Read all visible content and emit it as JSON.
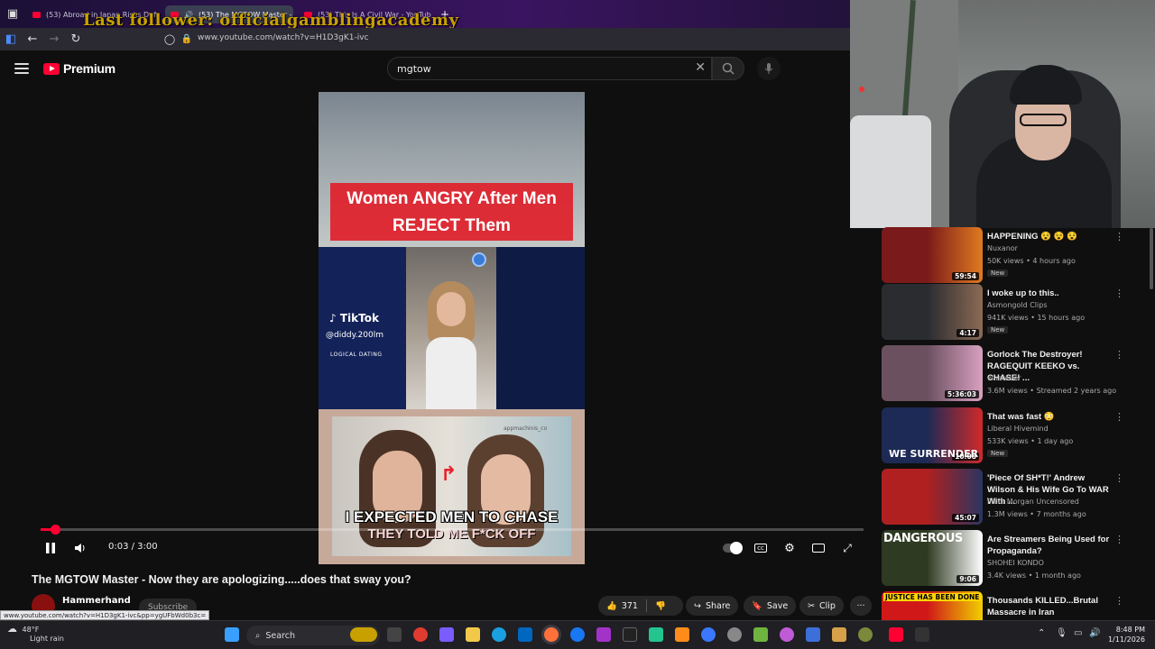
{
  "browser": {
    "tabs": [
      {
        "label": "(53) Abroad in Japan Risks Defa"
      },
      {
        "label": "(53) The MGTOW Master -"
      },
      {
        "label": "(53) This Is A Civil War - YouTub"
      }
    ],
    "new_tab_label": "+",
    "overlay_text": "Last follower: officialgamblingacademy",
    "url": "www.youtube.com/watch?v=H1D3gK1-ivc"
  },
  "youtube": {
    "brand": "Premium",
    "search_value": "mgtow",
    "accent": "#ff0033"
  },
  "video": {
    "banner_line1": "Women ANGRY After Men",
    "banner_line2": "REJECT Them",
    "tiktok_label": "TikTok",
    "tiktok_handle": "@diddy.200lm",
    "logical_label": "LOGICAL DATING",
    "caption_line1": "I EXPECTED MEN TO CHASE",
    "caption_line2": "THEY TOLD ME F*CK OFF",
    "watermark": "appmachinis_co"
  },
  "player": {
    "time": "0:03 / 3:00",
    "progress": 0.017
  },
  "meta": {
    "title": "The MGTOW Master - Now they are apologizing.....does that sway you?",
    "channel": "Hammerhand",
    "subscribe": "Subscribe",
    "likes": "371",
    "share": "Share",
    "save": "Save",
    "clip": "Clip",
    "more": "···",
    "status_url": "www.youtube.com/watch?v=H1D3gK1-ivc&pp=ygUFbWd0b3c="
  },
  "recommendations": [
    {
      "title": "HAPPENING 😵 😵 😵",
      "channel": "Nuxanor",
      "meta": "50K views • 4 hours ago",
      "badge": "New",
      "duration": "59:54",
      "thumb": "#7a1a1a",
      "thumb2": "#e07a20"
    },
    {
      "title": "I woke up to this..",
      "channel": "Asmongold Clips",
      "meta": "941K views • 15 hours ago",
      "badge": "New",
      "duration": "4:17",
      "thumb": "#2a2c30",
      "thumb2": "#8b6a55"
    },
    {
      "title": "Gorlock The Destroyer! RAGEQUIT KEEKO vs. CHASE! ...",
      "channel": "whatever",
      "meta": "3.6M views • Streamed 2 years ago",
      "badge": "",
      "duration": "5:36:03",
      "thumb": "#6b5060",
      "thumb2": "#d8a0c0"
    },
    {
      "title": "That was fast 😳",
      "channel": "Liberal Hivemind",
      "meta": "533K views • 1 day ago",
      "badge": "New",
      "duration": "10:08",
      "thumb": "#1d2a55",
      "thumb2": "#d02a2a"
    },
    {
      "title": "'Piece Of SH*T!' Andrew Wilson & His Wife Go To WAR With ...",
      "channel": "Piers Morgan Uncensored",
      "meta": "1.3M views • 7 months ago",
      "badge": "",
      "duration": "45:07",
      "thumb": "#b02020",
      "thumb2": "#2a3560"
    },
    {
      "title": "Are Streamers Being Used for Propaganda?",
      "channel": "SHOHEI KONDO",
      "meta": "3.4K views • 1 month ago",
      "badge": "",
      "duration": "9:06",
      "thumb": "#2f3a22",
      "thumb2": "#ffffff"
    },
    {
      "title": "Thousands KILLED...Brutal Massacre in Iran",
      "channel": "",
      "meta": "",
      "badge": "",
      "duration": "",
      "thumb": "#d01818",
      "thumb2": "#f0d000"
    }
  ],
  "rec_overlays": {
    "dangerous": "DANGEROUS",
    "justice": "JUSTICE HAS BEEN DONE",
    "surrender": "WE SURRENDER"
  },
  "taskbar": {
    "temp": "48°F",
    "weather": "Light rain",
    "search": "Search",
    "time": "8:48 PM",
    "date": "1/11/2026"
  }
}
